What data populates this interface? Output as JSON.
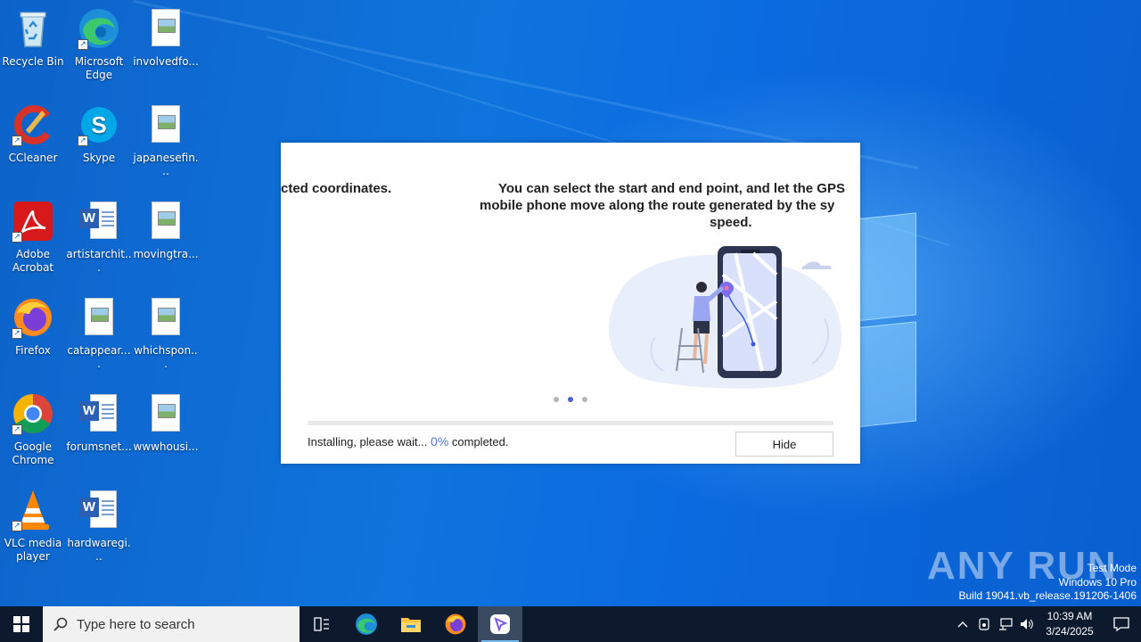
{
  "desktop": {
    "icons": [
      {
        "label": "Recycle Bin",
        "icon": "recycle-bin-icon"
      },
      {
        "label": "Microsoft Edge",
        "icon": "edge-icon"
      },
      {
        "label": "involvedfo...",
        "icon": "image-file-icon"
      },
      {
        "label": "CCleaner",
        "icon": "ccleaner-icon"
      },
      {
        "label": "Skype",
        "icon": "skype-icon"
      },
      {
        "label": "japanesefin...",
        "icon": "image-file-icon"
      },
      {
        "label": "Adobe Acrobat",
        "icon": "acrobat-icon"
      },
      {
        "label": "artistarchit...",
        "icon": "word-file-icon"
      },
      {
        "label": "movingtra...",
        "icon": "image-file-icon"
      },
      {
        "label": "Firefox",
        "icon": "firefox-icon"
      },
      {
        "label": "catappear....",
        "icon": "image-file-icon"
      },
      {
        "label": "whichspon...",
        "icon": "image-file-icon"
      },
      {
        "label": "Google Chrome",
        "icon": "chrome-icon"
      },
      {
        "label": "forumsnet...",
        "icon": "word-file-icon"
      },
      {
        "label": "wwwhousi...",
        "icon": "image-file-icon"
      },
      {
        "label": "VLC media player",
        "icon": "vlc-icon"
      },
      {
        "label": "hardwaregi...",
        "icon": "word-file-icon"
      }
    ]
  },
  "installer": {
    "prev_slide_text": "cted coordinates.",
    "slide_line1": "You can select the start and end point, and let the GPS",
    "slide_line2": "mobile phone move along the route generated by the sy",
    "slide_line3": "speed.",
    "dots": {
      "count": 3,
      "active_index": 1
    },
    "progress_fraction": 0.0,
    "status_prefix": "Installing, please wait...",
    "status_percent": "0%",
    "status_suffix": "completed.",
    "hide_label": "Hide"
  },
  "watermark": "ANY RUN",
  "system_info": {
    "line1": "Test Mode",
    "line2": "Windows 10 Pro",
    "line3": "Build 19041.vb_release.191206-1406"
  },
  "taskbar": {
    "search_placeholder": "Type here to search",
    "items": [
      "task-view-icon",
      "edge-icon",
      "file-explorer-icon",
      "firefox-icon",
      "installer-app-icon"
    ],
    "time": "10:39 AM",
    "date": "3/24/2025"
  },
  "colors": {
    "accent": "#4f74d6",
    "taskbar": "#0d1a2e",
    "desktop": "#0f74dd"
  }
}
